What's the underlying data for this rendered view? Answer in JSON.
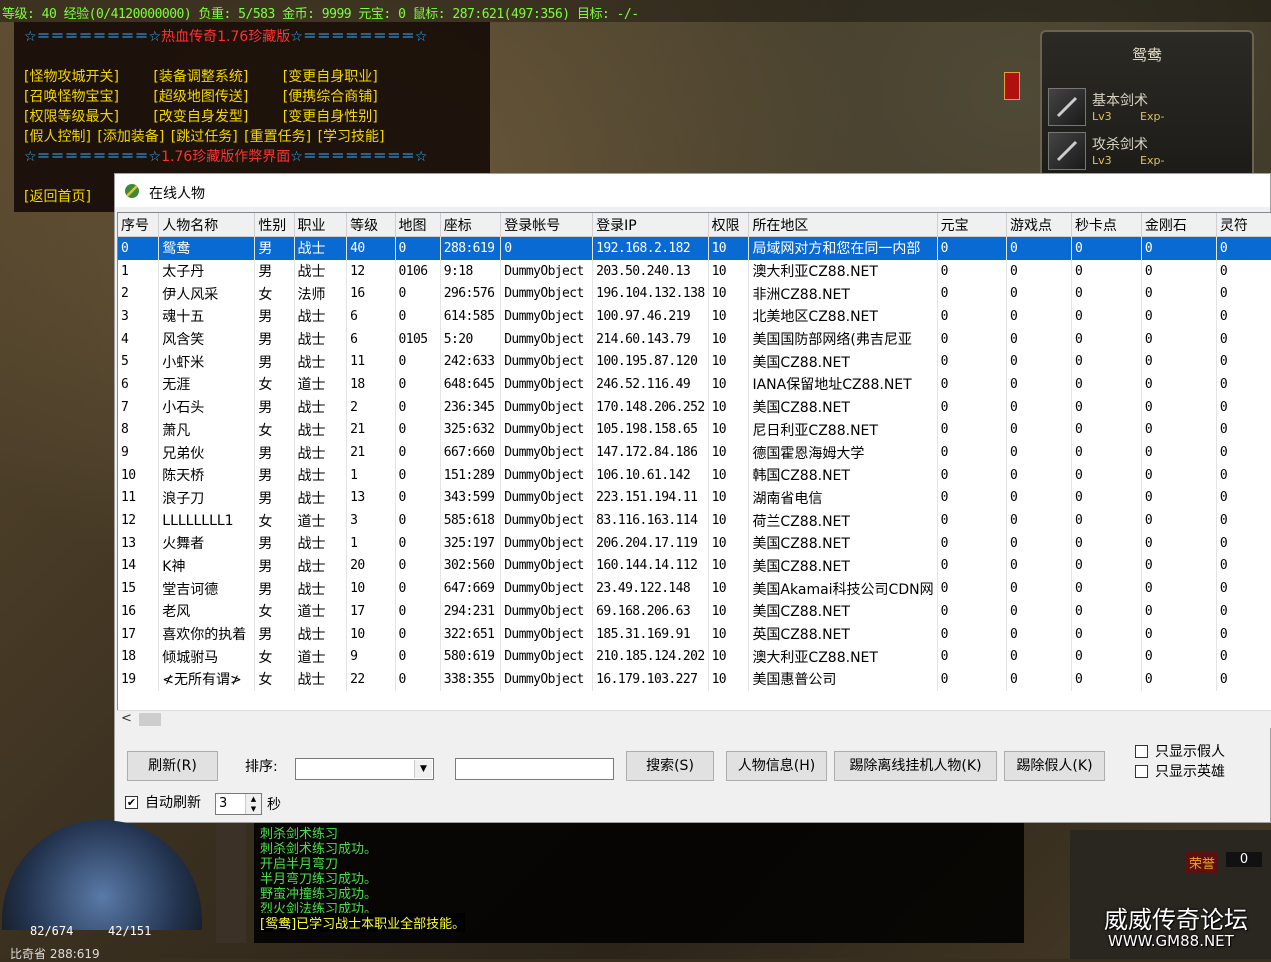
{
  "status_bar": "等级: 40 经验(0/4120000000) 负重: 5/583 金币: 9999 元宝: 0 鼠标: 287:621(497:356) 目标: -/-",
  "gm_menu": {
    "header_stars_left": "☆＝＝＝＝＝＝＝＝☆",
    "header_title": "热血传奇1.76珍藏版",
    "header_stars_right": "☆＝＝＝＝＝＝＝＝☆",
    "row1": [
      "[怪物攻城开关]",
      "[装备调整系统]",
      "[变更自身职业]"
    ],
    "row2": [
      "[召唤怪物宝宝]",
      "[超级地图传送]",
      "[便携综合商铺]"
    ],
    "row3": [
      "[权限等级最大]",
      "[改变自身发型]",
      "[变更自身性别]"
    ],
    "row4": [
      "[假人控制]",
      "[添加装备]",
      "[跳过任务]",
      "[重置任务]",
      "[学习技能]"
    ],
    "footer_stars_left": "☆＝＝＝＝＝＝＝＝☆",
    "footer_title": "1.76珍藏版作弊界面",
    "footer_stars_right": "☆＝＝＝＝＝＝＝＝☆",
    "return_link": "[返回首页]"
  },
  "skill_panel": {
    "title": "鸳鸯",
    "skills": [
      {
        "name": "基本剑术",
        "lv": "Lv3",
        "exp": "Exp-"
      },
      {
        "name": "攻杀剑术",
        "lv": "Lv3",
        "exp": "Exp-"
      }
    ]
  },
  "dialog": {
    "title": "在线人物",
    "columns": [
      "序号",
      "人物名称",
      "性别",
      "职业",
      "等级",
      "地图",
      "座标",
      "登录帐号",
      "登录IP",
      "权限",
      "所在地区",
      "元宝",
      "游戏点",
      "秒卡点",
      "金刚石",
      "灵符"
    ],
    "rows": [
      [
        "0",
        "鸳鸯",
        "男",
        "战士",
        "40",
        "0",
        "288:619",
        "0",
        "192.168.2.182",
        "10",
        "局域网对方和您在同一内部",
        "0",
        "0",
        "0",
        "0",
        "0"
      ],
      [
        "1",
        "太子丹",
        "男",
        "战士",
        "12",
        "0106",
        "9:18",
        "DummyObject",
        "203.50.240.13",
        "10",
        "澳大利亚CZ88.NET",
        "0",
        "0",
        "0",
        "0",
        "0"
      ],
      [
        "2",
        "伊人风采",
        "女",
        "法师",
        "16",
        "0",
        "296:576",
        "DummyObject",
        "196.104.132.138",
        "10",
        "非洲CZ88.NET",
        "0",
        "0",
        "0",
        "0",
        "0"
      ],
      [
        "3",
        "魂十五",
        "男",
        "战士",
        "6",
        "0",
        "614:585",
        "DummyObject",
        "100.97.46.219",
        "10",
        "北美地区CZ88.NET",
        "0",
        "0",
        "0",
        "0",
        "0"
      ],
      [
        "4",
        "风含笑",
        "男",
        "战士",
        "6",
        "0105",
        "5:20",
        "DummyObject",
        "214.60.143.79",
        "10",
        "美国国防部网络(弗吉尼亚",
        "0",
        "0",
        "0",
        "0",
        "0"
      ],
      [
        "5",
        "小虾米",
        "男",
        "战士",
        "11",
        "0",
        "242:633",
        "DummyObject",
        "100.195.87.120",
        "10",
        "美国CZ88.NET",
        "0",
        "0",
        "0",
        "0",
        "0"
      ],
      [
        "6",
        "无涯",
        "女",
        "道士",
        "18",
        "0",
        "648:645",
        "DummyObject",
        "246.52.116.49",
        "10",
        "IANA保留地址CZ88.NET",
        "0",
        "0",
        "0",
        "0",
        "0"
      ],
      [
        "7",
        "小石头",
        "男",
        "战士",
        "2",
        "0",
        "236:345",
        "DummyObject",
        "170.148.206.252",
        "10",
        "美国CZ88.NET",
        "0",
        "0",
        "0",
        "0",
        "0"
      ],
      [
        "8",
        "萧凡",
        "女",
        "战士",
        "21",
        "0",
        "325:632",
        "DummyObject",
        "105.198.158.65",
        "10",
        "尼日利亚CZ88.NET",
        "0",
        "0",
        "0",
        "0",
        "0"
      ],
      [
        "9",
        "兄弟伙",
        "男",
        "战士",
        "21",
        "0",
        "667:660",
        "DummyObject",
        "147.172.84.186",
        "10",
        "德国霍恩海姆大学",
        "0",
        "0",
        "0",
        "0",
        "0"
      ],
      [
        "10",
        "陈天桥",
        "男",
        "战士",
        "1",
        "0",
        "151:289",
        "DummyObject",
        "106.10.61.142",
        "10",
        "韩国CZ88.NET",
        "0",
        "0",
        "0",
        "0",
        "0"
      ],
      [
        "11",
        "浪子刀",
        "男",
        "战士",
        "13",
        "0",
        "343:599",
        "DummyObject",
        "223.151.194.11",
        "10",
        "湖南省电信",
        "0",
        "0",
        "0",
        "0",
        "0"
      ],
      [
        "12",
        "LLLLLLLL1",
        "女",
        "道士",
        "3",
        "0",
        "585:618",
        "DummyObject",
        "83.116.163.114",
        "10",
        "荷兰CZ88.NET",
        "0",
        "0",
        "0",
        "0",
        "0"
      ],
      [
        "13",
        "火舞者",
        "男",
        "战士",
        "1",
        "0",
        "325:197",
        "DummyObject",
        "206.204.17.119",
        "10",
        "美国CZ88.NET",
        "0",
        "0",
        "0",
        "0",
        "0"
      ],
      [
        "14",
        "K神",
        "男",
        "战士",
        "20",
        "0",
        "302:560",
        "DummyObject",
        "160.144.14.112",
        "10",
        "美国CZ88.NET",
        "0",
        "0",
        "0",
        "0",
        "0"
      ],
      [
        "15",
        "堂吉诃德",
        "男",
        "战士",
        "10",
        "0",
        "647:669",
        "DummyObject",
        "23.49.122.148",
        "10",
        "美国Akamai科技公司CDN网",
        "0",
        "0",
        "0",
        "0",
        "0"
      ],
      [
        "16",
        "老风",
        "女",
        "道士",
        "17",
        "0",
        "294:231",
        "DummyObject",
        "69.168.206.63",
        "10",
        "美国CZ88.NET",
        "0",
        "0",
        "0",
        "0",
        "0"
      ],
      [
        "17",
        "喜欢你的执着",
        "男",
        "战士",
        "10",
        "0",
        "322:651",
        "DummyObject",
        "185.31.169.91",
        "10",
        "英国CZ88.NET",
        "0",
        "0",
        "0",
        "0",
        "0"
      ],
      [
        "18",
        "倾城驸马",
        "女",
        "道士",
        "9",
        "0",
        "580:619",
        "DummyObject",
        "210.185.124.202",
        "10",
        "澳大利亚CZ88.NET",
        "0",
        "0",
        "0",
        "0",
        "0"
      ],
      [
        "19",
        "≮无所有谓≯",
        "女",
        "战士",
        "22",
        "0",
        "338:355",
        "DummyObject",
        "16.179.103.227",
        "10",
        "美国惠普公司",
        "0",
        "0",
        "0",
        "0",
        "0"
      ]
    ],
    "selected_row": 0,
    "scroll_left_arrow": "<",
    "refresh_button": "刷新(R)",
    "sort_label": "排序:",
    "sort_value": "",
    "search_value": "",
    "search_button": "搜索(S)",
    "info_button": "人物信息(H)",
    "kick_offline_button": "踢除离线挂机人物(K)",
    "kick_fake_button": "踢除假人(K)",
    "only_fake_label": "只显示假人",
    "only_hero_label": "只显示英雄",
    "auto_refresh_label": "自动刷新",
    "auto_refresh_checked": "✔",
    "auto_refresh_value": "3",
    "seconds_label": "秒"
  },
  "chat": {
    "lines": [
      "刺杀剑术练习",
      "刺杀剑术练习成功。",
      "开启半月弯刀",
      "半月弯刀练习成功。",
      "野蛮冲撞练习成功。",
      "烈火剑法练习成功。"
    ],
    "highlight": "[鸳鸯]已学习战士本职业全部技能。"
  },
  "hud": {
    "hp": "82/674",
    "mp": "42/151",
    "map_coord": "比奇省 288:619",
    "honor_label": "荣誉",
    "honor_value": "0"
  },
  "watermark": "威威传奇论坛",
  "watermark_url": "WWW.GM88.NET",
  "colors": {
    "selection": "#0a6ad4",
    "status_green": "#7cff3a",
    "gm_link": "#f3d500"
  }
}
